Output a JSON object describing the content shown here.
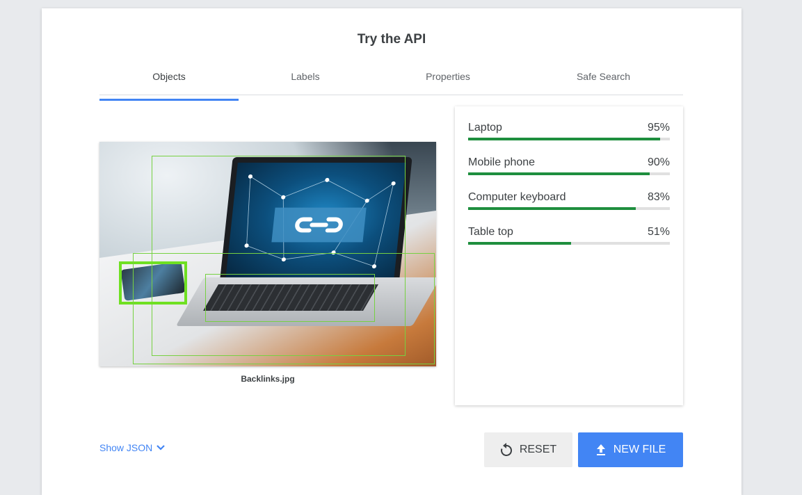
{
  "page": {
    "title": "Try the API"
  },
  "tabs": [
    {
      "label": "Objects",
      "active": true
    },
    {
      "label": "Labels",
      "active": false
    },
    {
      "label": "Properties",
      "active": false
    },
    {
      "label": "Safe Search",
      "active": false
    }
  ],
  "image": {
    "filename": "Backlinks.jpg"
  },
  "results": [
    {
      "name": "Laptop",
      "percent": "95%",
      "score": 0.95
    },
    {
      "name": "Mobile phone",
      "percent": "90%",
      "score": 0.9
    },
    {
      "name": "Computer keyboard",
      "percent": "83%",
      "score": 0.83
    },
    {
      "name": "Table top",
      "percent": "51%",
      "score": 0.51
    }
  ],
  "footer": {
    "show_json": "Show JSON",
    "reset_label": "RESET",
    "new_file_label": "NEW FILE"
  },
  "colors": {
    "accent": "#4285f4",
    "bar_fill": "#1e8e3e",
    "bbox": "#76d141"
  },
  "icons": {
    "show_json": "chevron-down-icon",
    "reset": "reset-icon",
    "new_file": "upload-icon"
  }
}
